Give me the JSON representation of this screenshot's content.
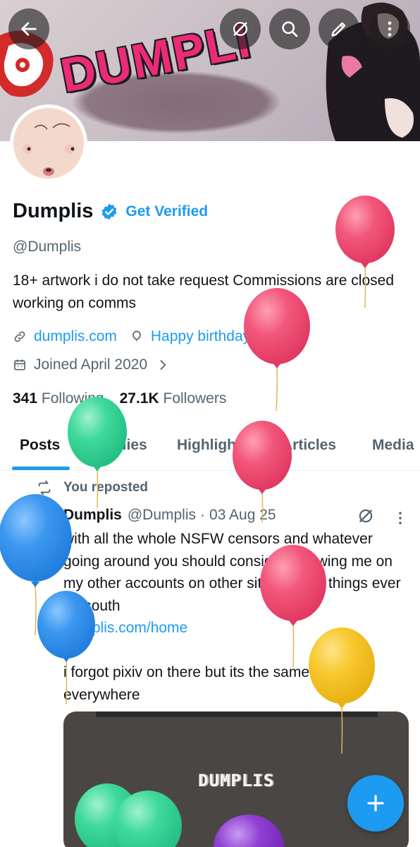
{
  "banner": {
    "logo_text": "DUMPLI",
    "actions": {
      "back_icon": "arrow-left-icon",
      "grok_icon": "grok-icon",
      "search_icon": "search-icon",
      "edit_icon": "pencil-icon",
      "more_icon": "more-vertical-icon"
    }
  },
  "profile": {
    "display_name": "Dumplis",
    "get_verified": "Get Verified",
    "handle": "@Dumplis",
    "bio": "18+ artwork i do not take request Commissions are closed working on comms",
    "website": "dumplis.com",
    "birthday": "Happy birthday!",
    "joined": "Joined April 2020",
    "following_count": "341",
    "following_label": "Following",
    "followers_count": "27.1K",
    "followers_label": "Followers"
  },
  "tabs": [
    {
      "label": "Posts",
      "active": true
    },
    {
      "label": "Replies",
      "active": false
    },
    {
      "label": "Highlights",
      "active": false
    },
    {
      "label": "Articles",
      "active": false
    },
    {
      "label": "Media",
      "active": false
    }
  ],
  "post": {
    "repost_label": "You reposted",
    "author": "Dumplis",
    "handle": "@Dumplis",
    "separator": "·",
    "date": "03 Aug 25",
    "text_1": "with all the whole NSFW censors and whatever going around you should consider following me on my other accounts on other sites incase things ever go south",
    "link": "dumplis.com/home",
    "text_2": "i forgot pixiv on there but its the same name as everywhere",
    "media_title": "DUMPLIS"
  },
  "fab": {
    "icon": "plus-icon"
  },
  "colors": {
    "accent": "#1d9bf0",
    "text_primary": "#0f1419",
    "text_secondary": "#536471",
    "balloon_pink": "#f2587c",
    "balloon_blue": "#3b97ef",
    "balloon_green": "#3fd99a",
    "balloon_yellow": "#f7c82f",
    "balloon_purple": "#8f3fd1"
  }
}
